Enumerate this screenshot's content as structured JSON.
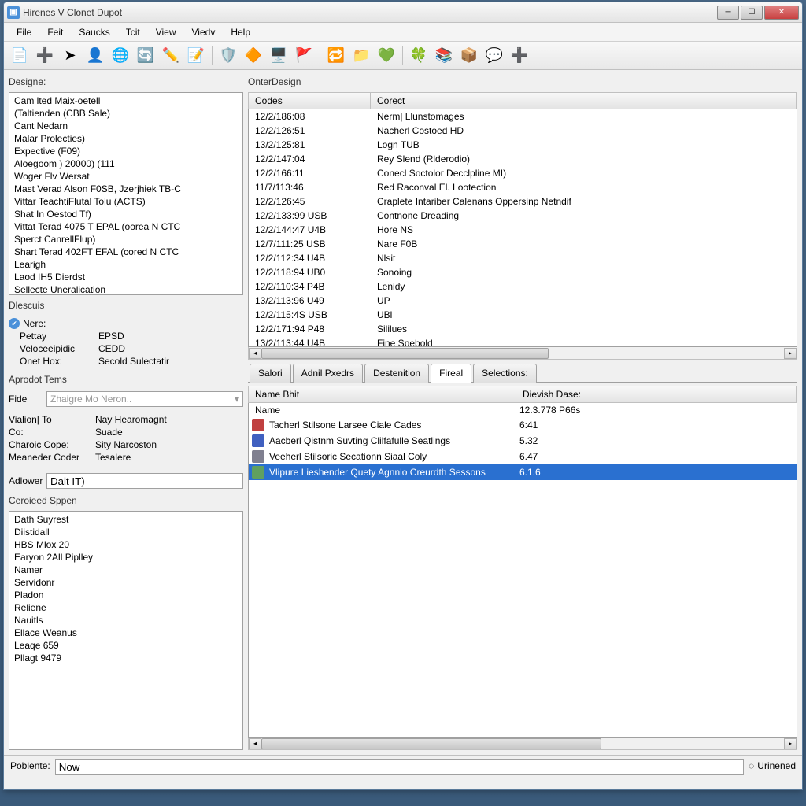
{
  "window": {
    "title": "Hirenes V Clonet Dupot"
  },
  "menubar": [
    "File",
    "Feit",
    "Saucks",
    "Tcit",
    "View",
    "Viedv",
    "Help"
  ],
  "toolbar_icons": [
    "page",
    "plus-red",
    "arrow-blue",
    "person-green",
    "globe",
    "refresh",
    "pencil",
    "edit-box",
    "shield-blue",
    "diamond-yellow",
    "window-blue",
    "flag-orange",
    "swap-red",
    "folder-yellow",
    "heart-green",
    "clover",
    "stack-pink",
    "box",
    "chat",
    "plus-gray"
  ],
  "left": {
    "designe_label": "Designe:",
    "designe_items": [
      "Cam lted Maix-oetell",
      "(Taltienden (CBB Sale)",
      "Cant Nedarn",
      "Malar Prolecties)",
      "Expective (F09)",
      "Aloegoom ) 20000) (111",
      "Woger Flv Wersat",
      "Mast Verad Alson F0SB, Jzerjhiek TB-C",
      "Vittar TeachtiFlutal Tolu (ACTS)",
      "Shat In Oestod Tf)",
      "Vittat Terad 4075 T EPAL (oorea N CTC",
      "Sperct CanrellFlup)",
      "Shart Terad 402FT EFAL (cored N CTC",
      "Learigh",
      "Laod IH5 Dierdst",
      "Sellecte Uneralication"
    ],
    "descuis_label": "Dlescuis",
    "desc_nere": "Nere:",
    "desc_kv": [
      {
        "k": "Pettay",
        "v": "EPSD"
      },
      {
        "k": "Veloceeipidic",
        "v": "CEDD"
      },
      {
        "k": "Onet Hox:",
        "v": "Secold Sulectatir"
      }
    ],
    "aprodot_label": "Aprodot Tems",
    "fide_label": "Fide",
    "fide_placeholder": "Zhaigre Mo Neron..",
    "info_rows": [
      {
        "k": "Vialion| To",
        "v": "Nay Hearomagnt"
      },
      {
        "k": "Co:",
        "v": "Suade"
      },
      {
        "k": "Charoic Cope:",
        "v": "Sity Narcoston"
      },
      {
        "k": "Meaneder Coder",
        "v": "Tesalere"
      }
    ],
    "adower_label": "Adlower",
    "adower_value": "Dalt IT)",
    "ceroieed_label": "Ceroieed Sppen",
    "ceroieed_items": [
      "Dath Suyrest",
      "Diistidall",
      "HBS Mlox 20",
      "Earyon 2All Piplley",
      "Namer",
      "Servidonr",
      "Pladon",
      "Reliene",
      "Nauitls",
      "Ellace Weanus",
      "Leaqe 659",
      "Pllagt 9479"
    ]
  },
  "right": {
    "onter_label": "OnterDesign",
    "grid_headers": {
      "codes": "Codes",
      "corect": "Corect"
    },
    "grid_rows": [
      {
        "c": "12/2/186:08",
        "t": "Nerm| Llunstomages"
      },
      {
        "c": "12/2/126:51",
        "t": "Nacherl Costoed HD"
      },
      {
        "c": "13/2/125:81",
        "t": "Logn TUB"
      },
      {
        "c": "12/2/147:04",
        "t": "Rey Slend (Rlderodio)"
      },
      {
        "c": "12/2/166:11",
        "t": "Conecl Soctolor Decclpline MI)"
      },
      {
        "c": "11/7/113:46",
        "t": "Red Raconval El. Lootection"
      },
      {
        "c": "12/2/126:45",
        "t": "Craplete Intariber Calenans Oppersinp Netndif"
      },
      {
        "c": "12/2/133:99 USB",
        "t": "Contnone Dreading"
      },
      {
        "c": "12/2/144:47 U4B",
        "t": "Hore NS"
      },
      {
        "c": "12/7/111:25 USB",
        "t": "Nare F0B"
      },
      {
        "c": "12/2/112:34 U4B",
        "t": "Nlsit"
      },
      {
        "c": "12/2/118:94 UB0",
        "t": "Sonoing"
      },
      {
        "c": "12/2/110:34 P4B",
        "t": "Lenidy"
      },
      {
        "c": "13/2/113:96 U49",
        "t": "UP"
      },
      {
        "c": "12/2/115:4S USB",
        "t": "UBl"
      },
      {
        "c": "12/2/171:94 P48",
        "t": "Sililues"
      },
      {
        "c": "13/2/113:44 U4B",
        "t": "Fine Spebold"
      }
    ],
    "tabs": [
      "Salori",
      "Adnil Pxedrs",
      "Destenition",
      "Fireal",
      "Selections:"
    ],
    "active_tab": 3,
    "lower_headers": {
      "name": "Name Bhit",
      "date": "Dievish Dase:"
    },
    "lower_toprow": {
      "name": "Name",
      "date": "12.3.778 P66s"
    },
    "lower_rows": [
      {
        "icon": "ic-red",
        "name": "Tacherl Stilsone Larsee Ciale Cades",
        "date": "6:41",
        "sel": false
      },
      {
        "icon": "ic-blue",
        "name": "Aacberl Qistnm Suvting Clilfafulle Seatlings",
        "date": "5.32",
        "sel": false
      },
      {
        "icon": "ic-gray",
        "name": "Veeherl Stilsoric Secationn Siaal Coly",
        "date": "6.47",
        "sel": false
      },
      {
        "icon": "ic-green",
        "name": "Vlipure Lieshender Quety Agnnlo Creurdth Sessons",
        "date": "6.1.6",
        "sel": true
      }
    ]
  },
  "status": {
    "poblente_label": "Poblente:",
    "poblente_value": "Now",
    "right": "Urinened"
  }
}
